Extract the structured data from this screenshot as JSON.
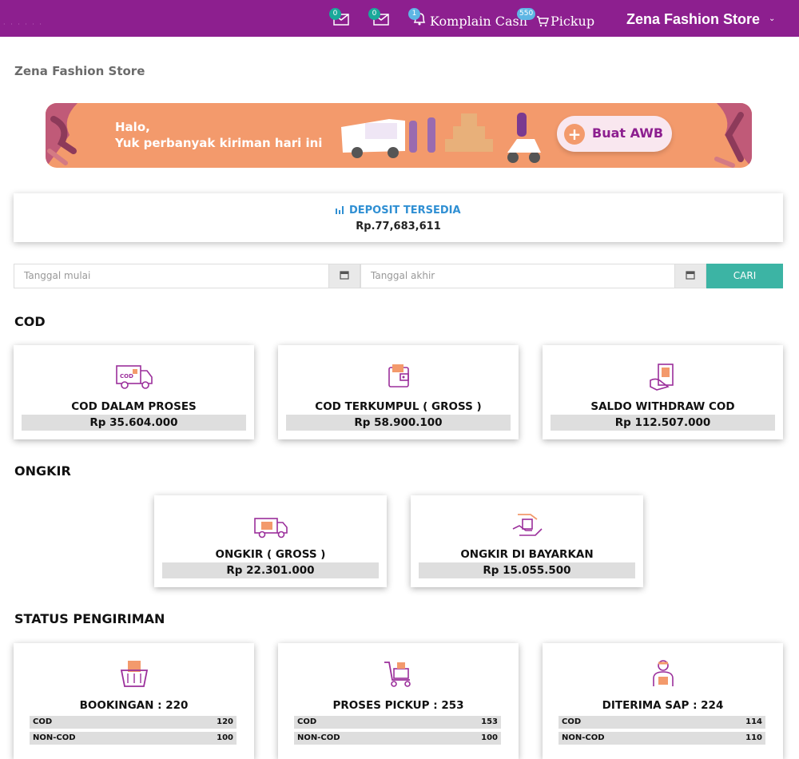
{
  "topbar": {
    "mail1_count": "0",
    "mail2_count": "0",
    "bell_count": "1",
    "komplain_label": "Komplain Cash",
    "pickup_count": "550",
    "pickup_label": "Pickup",
    "store_name": "Zena Fashion Store",
    "bg_color": "#8d1f8f"
  },
  "page": {
    "title": "Zena Fashion Store"
  },
  "banner": {
    "greeting_line1": "Halo,",
    "greeting_line2": "Yuk perbanyak kiriman hari ini",
    "button_label": "Buat AWB",
    "bg_color": "#f39a6c"
  },
  "deposit": {
    "label": "DEPOSIT TERSEDIA",
    "value": "Rp.77,683,611",
    "icon": "bar-chart-icon"
  },
  "filter": {
    "start_placeholder": "Tanggal mulai",
    "end_placeholder": "Tanggal akhir",
    "search_label": "CARI",
    "search_color": "#3cb4a4"
  },
  "cod": {
    "title": "COD",
    "cards": [
      {
        "label": "COD DALAM PROSES",
        "value": "Rp 35.604.000",
        "icon": "cod-truck-icon"
      },
      {
        "label": "COD TERKUMPUL ( GROSS )",
        "value": "Rp 58.900.100",
        "icon": "wallet-icon"
      },
      {
        "label": "SALDO WITHDRAW COD",
        "value": "Rp 112.507.000",
        "icon": "atm-withdraw-icon"
      }
    ]
  },
  "ongkir": {
    "title": "ONGKIR",
    "cards": [
      {
        "label": "ONGKIR ( GROSS )",
        "value": "Rp 22.301.000",
        "icon": "delivery-truck-icon"
      },
      {
        "label": "ONGKIR DI BAYARKAN",
        "value": "Rp 15.055.500",
        "icon": "hand-payment-icon"
      }
    ]
  },
  "status": {
    "title": "STATUS PENGIRIMAN",
    "cards": [
      {
        "label": "BOOKINGAN : 220",
        "icon": "basket-icon",
        "rows": [
          {
            "k": "COD",
            "v": "120"
          },
          {
            "k": "NON-COD",
            "v": "100"
          }
        ]
      },
      {
        "label": "PROSES PICKUP : 253",
        "icon": "cart-icon",
        "rows": [
          {
            "k": "COD",
            "v": "153"
          },
          {
            "k": "NON-COD",
            "v": "100"
          }
        ]
      },
      {
        "label": "DITERIMA SAP : 224",
        "icon": "courier-icon",
        "rows": [
          {
            "k": "COD",
            "v": "114"
          },
          {
            "k": "NON-COD",
            "v": "110"
          }
        ]
      }
    ]
  }
}
